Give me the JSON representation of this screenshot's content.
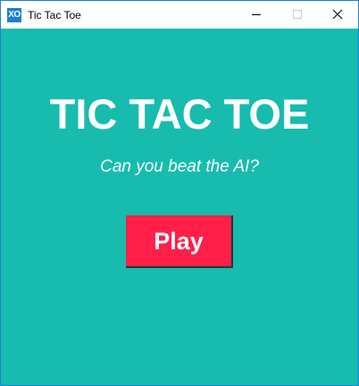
{
  "window": {
    "title": "Tic Tac Toe",
    "icon_text": "XO",
    "icon_name": "xo-app-icon",
    "controls": {
      "minimize": "minimize-icon",
      "maximize": "maximize-icon",
      "close": "close-icon"
    }
  },
  "main": {
    "heading": "TIC TAC TOE",
    "subtitle": "Can you beat the AI?",
    "play_label": "Play"
  },
  "colors": {
    "background": "#17bcae",
    "play_button": "#ff1f48",
    "text": "#ffffff",
    "icon_blue": "#1a7fd4"
  }
}
